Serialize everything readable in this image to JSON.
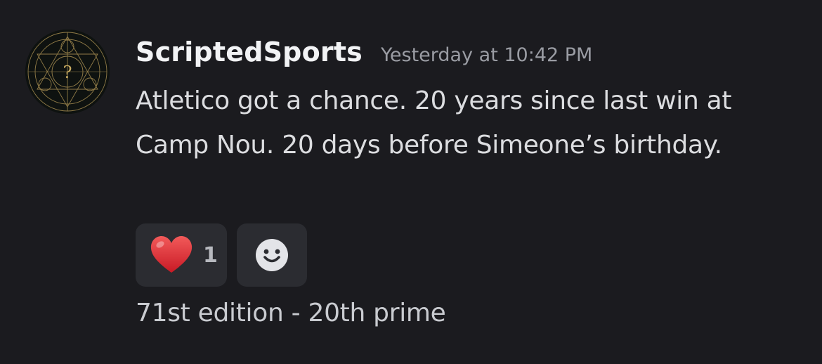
{
  "message": {
    "username": "ScriptedSports",
    "timestamp": "Yesterday at 10:42 PM",
    "content": "Atletico got a chance. 20 years since last win at Camp Nou. 20 days before Simeone’s birthday.",
    "avatar_icon": "mystic-circle-avatar"
  },
  "reactions": [
    {
      "icon": "red-heart-emoji",
      "count": "1"
    },
    {
      "icon": "add-reaction-smiley-icon"
    }
  ],
  "footer": {
    "text": "71st edition - 20th prime"
  },
  "colors": {
    "background": "#1b1b1f",
    "username": "#f2f3f5",
    "timestamp": "#9a9ca3",
    "reaction_bg": "#2b2c31",
    "avatar_gold": "#b59a55"
  }
}
